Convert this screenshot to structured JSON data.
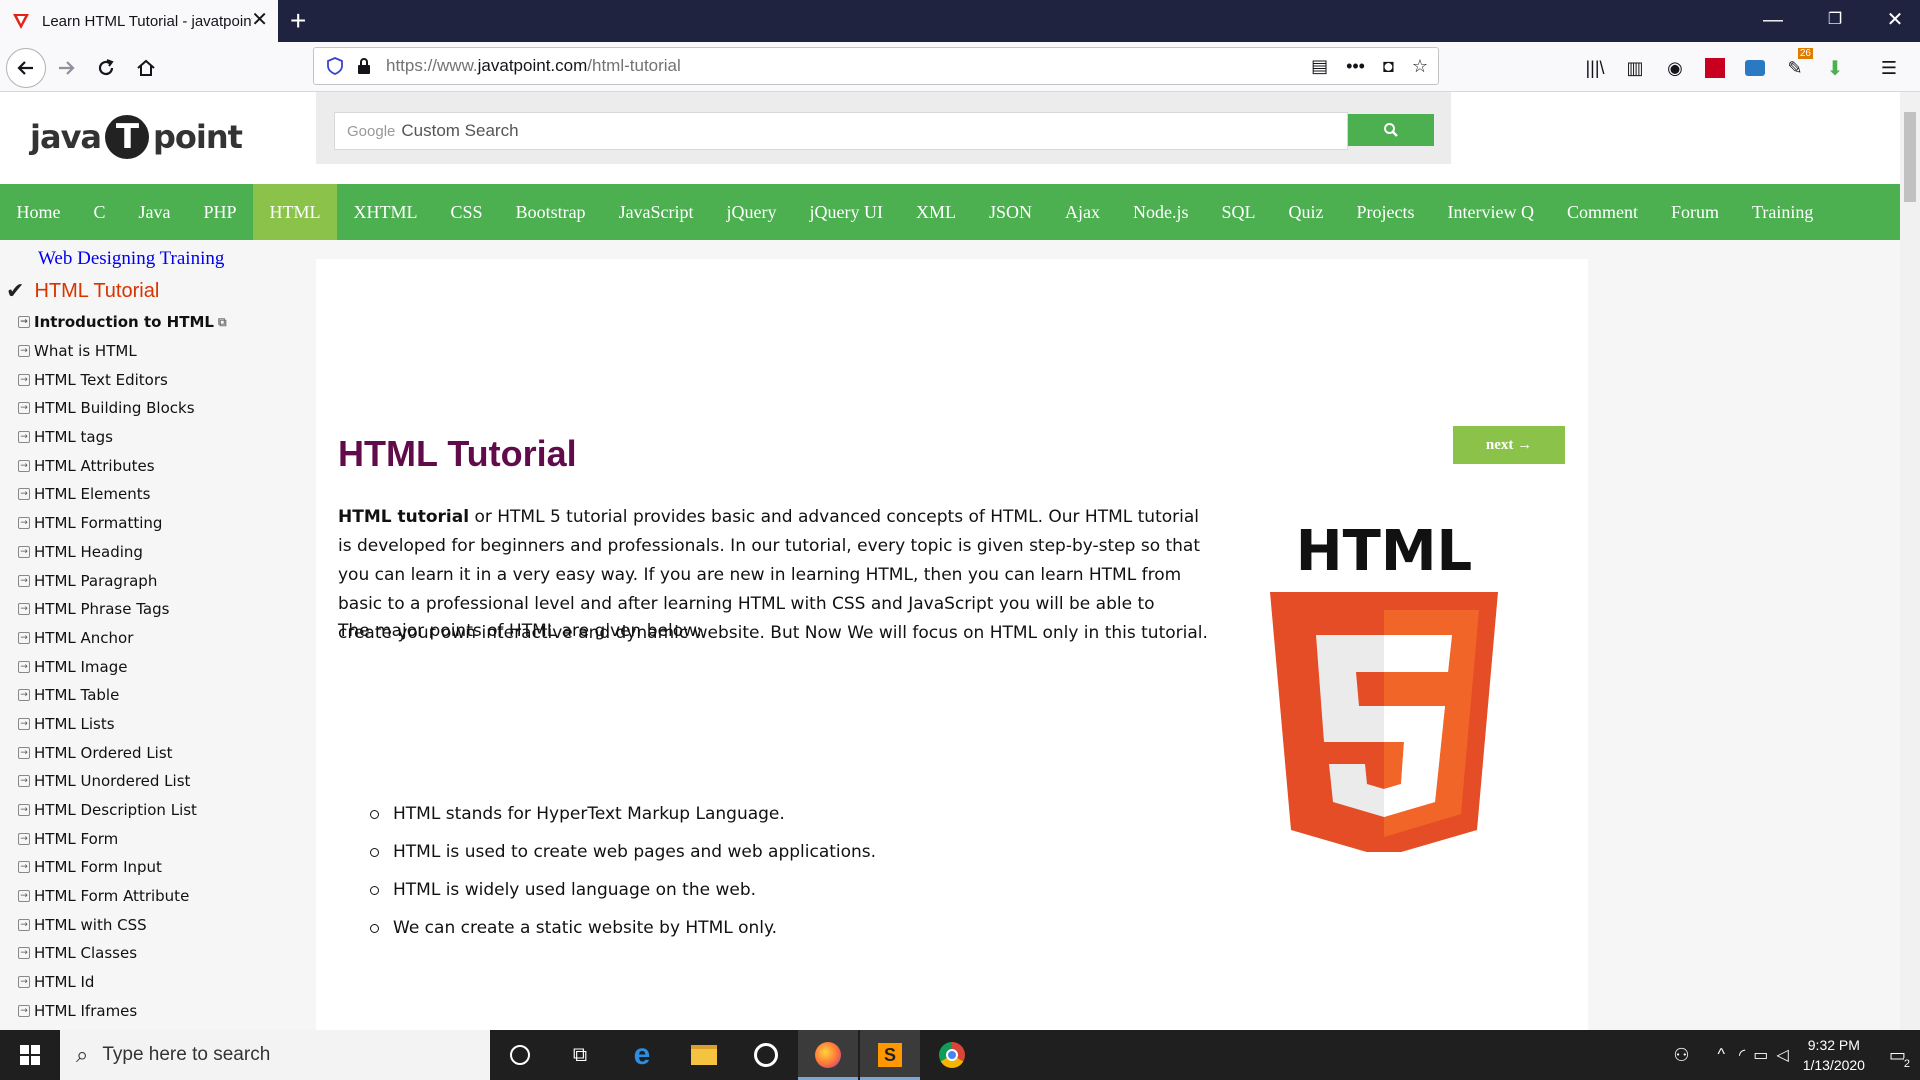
{
  "browser": {
    "tab_title": "Learn HTML Tutorial - javatpoint",
    "url_scheme": "https://www.",
    "url_host": "javatpoint.com",
    "url_path": "/html-tutorial",
    "extension_badge": "26"
  },
  "header": {
    "logo_left": "java",
    "logo_mid": "T",
    "logo_right": "point",
    "search_google": "Google",
    "search_placeholder": "Custom Search"
  },
  "menu": [
    {
      "label": "Home"
    },
    {
      "label": "C"
    },
    {
      "label": "Java"
    },
    {
      "label": "PHP"
    },
    {
      "label": "HTML",
      "active": true
    },
    {
      "label": "XHTML"
    },
    {
      "label": "CSS"
    },
    {
      "label": "Bootstrap"
    },
    {
      "label": "JavaScript"
    },
    {
      "label": "jQuery"
    },
    {
      "label": "jQuery UI"
    },
    {
      "label": "XML"
    },
    {
      "label": "JSON"
    },
    {
      "label": "Ajax"
    },
    {
      "label": "Node.js"
    },
    {
      "label": "SQL"
    },
    {
      "label": "Quiz"
    },
    {
      "label": "Projects"
    },
    {
      "label": "Interview Q"
    },
    {
      "label": "Comment"
    },
    {
      "label": "Forum"
    },
    {
      "label": "Training"
    }
  ],
  "sidebar": {
    "training_link": "Web Designing Training",
    "current": "HTML Tutorial",
    "items": [
      "Introduction to HTML",
      "What is HTML",
      "HTML Text Editors",
      "HTML Building Blocks",
      "HTML tags",
      "HTML Attributes",
      "HTML Elements",
      "HTML Formatting",
      "HTML Heading",
      "HTML Paragraph",
      "HTML Phrase Tags",
      "HTML Anchor",
      "HTML Image",
      "HTML Table",
      "HTML Lists",
      "HTML Ordered List",
      "HTML Unordered List",
      "HTML Description List",
      "HTML Form",
      "HTML Form Input",
      "HTML Form Attribute",
      "HTML with CSS",
      "HTML Classes",
      "HTML Id",
      "HTML Iframes"
    ]
  },
  "content": {
    "title": "HTML Tutorial",
    "next_label": "next →",
    "intro_bold": "HTML tutorial",
    "intro_rest": " or HTML 5 tutorial provides basic and advanced concepts of HTML. Our HTML tutorial is developed for beginners and professionals. In our tutorial, every topic is given step-by-step so that you can learn it in a very easy way. If you are new in learning HTML, then you can learn HTML from basic to a professional level and after learning HTML with CSS and JavaScript you will be able to create your own interactive and dynamic website. But Now We will focus on HTML only in this tutorial.",
    "points_intro": "The major points of HTML are given below:",
    "logo_text": "HTML",
    "logo_digit": "5",
    "points": [
      "HTML stands for HyperText Markup Language.",
      "HTML is used to create web pages and web applications.",
      "HTML is widely used language on the web.",
      "We can create a static website by HTML only."
    ]
  },
  "taskbar": {
    "search_placeholder": "Type here to search",
    "time": "9:32 PM",
    "date": "1/13/2020",
    "notifications": "2"
  },
  "colors": {
    "menu_green": "#4caf50",
    "menu_active": "#8bc34a",
    "title_color": "#610b4b",
    "html5_orange": "#e44d26",
    "html5_light": "#f16529"
  }
}
